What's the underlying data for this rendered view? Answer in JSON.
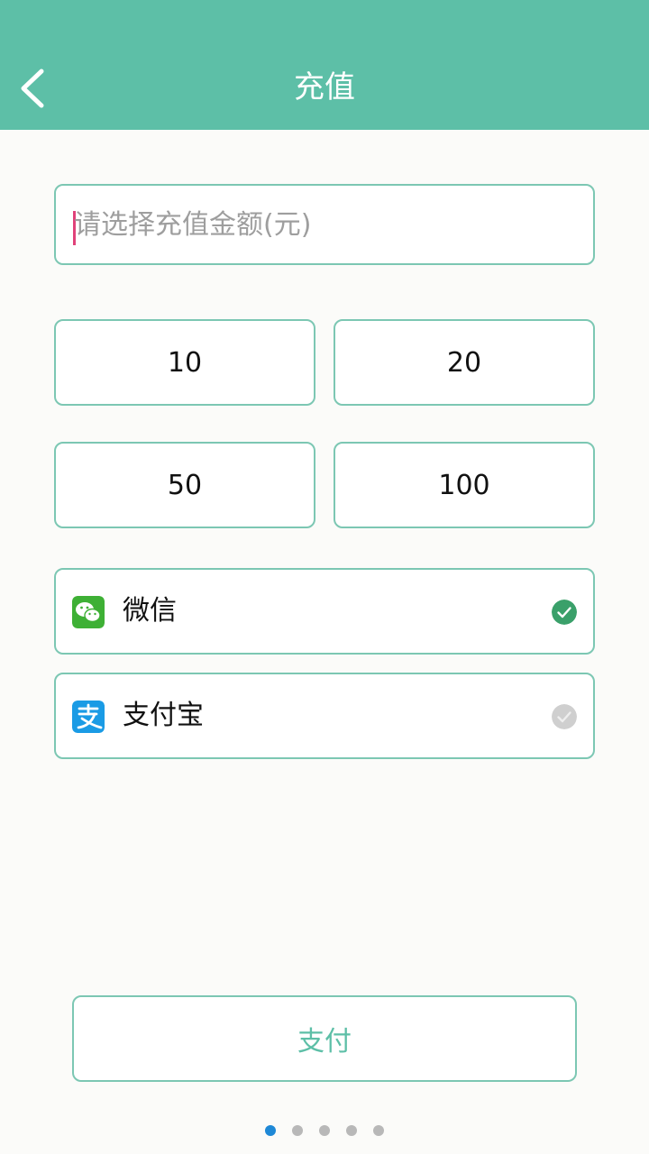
{
  "header": {
    "title": "充值"
  },
  "amount_input": {
    "placeholder": "请选择充值金额(元)",
    "value": ""
  },
  "amount_options": [
    {
      "label": "10"
    },
    {
      "label": "20"
    },
    {
      "label": "50"
    },
    {
      "label": "100"
    }
  ],
  "payment_methods": [
    {
      "label": "微信",
      "selected": true,
      "icon": "wechat-icon"
    },
    {
      "label": "支付宝",
      "selected": false,
      "icon": "alipay-icon"
    }
  ],
  "pay_button": {
    "label": "支付"
  },
  "pagination": {
    "total": 5,
    "active_index": 0
  },
  "colors": {
    "header_bg": "#5dbfa7",
    "border": "#7cc7b3",
    "selected_check": "#3aa06a",
    "unselected_check": "#cfcfcf",
    "wechat": "#3eb035",
    "alipay": "#1a9be5",
    "active_dot": "#1e88d6"
  }
}
